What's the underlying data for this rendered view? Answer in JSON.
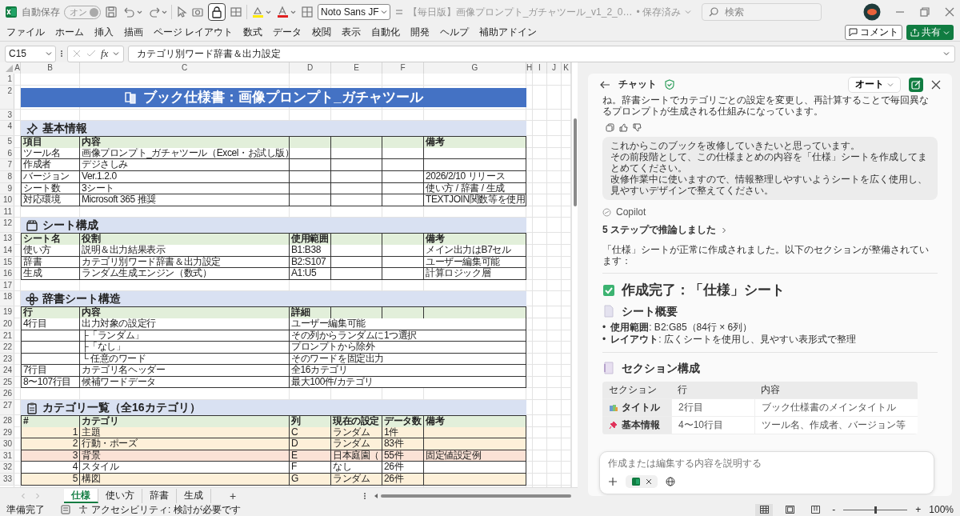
{
  "title_bar": {
    "autosave_label": "自動保存",
    "autosave": {
      "label": "オン",
      "on": true,
      "disabled": true
    },
    "font_name": "Noto Sans JF",
    "file_name": "【毎日版】画像プロンプト_ガチャツール_v1_2_0…",
    "save_status": "• 保存済み",
    "search": {
      "placeholder": "検索"
    }
  },
  "menu": {
    "items": [
      "ファイル",
      "ホーム",
      "挿入",
      "描画",
      "ページ レイアウト",
      "数式",
      "データ",
      "校閲",
      "表示",
      "自動化",
      "開発",
      "ヘルプ",
      "補助アドイン"
    ],
    "comment_button": "コメント",
    "share_button": "共有"
  },
  "formula_bar": {
    "cell": "C15",
    "fx": "fx",
    "formula": "カテゴリ別ワード辞書＆出力設定"
  },
  "sheet": {
    "columns": [
      "A",
      "B",
      "C",
      "D",
      "E",
      "F",
      "G",
      "H",
      "I",
      "J",
      "K"
    ],
    "rows": [
      {
        "number": "1",
        "kind": "blank"
      },
      {
        "number": "2",
        "kind": "title",
        "text": "ブック仕様書：画像プロンプト_ガチャツール"
      },
      {
        "number": "3",
        "kind": "blank"
      },
      {
        "number": "4",
        "kind": "section",
        "text": "基本情報"
      },
      {
        "number": "5",
        "kind": "header",
        "cells": {
          "B": "項目",
          "C": "内容",
          "G": "備考"
        }
      },
      {
        "number": "6",
        "kind": "data",
        "cells": {
          "B": "ツール名",
          "C": "画像プロンプト_ガチャツール（Excel・お試し版）"
        }
      },
      {
        "number": "7",
        "kind": "data",
        "cells": {
          "B": "作成者",
          "C": "デジさしみ"
        }
      },
      {
        "number": "8",
        "kind": "data",
        "cells": {
          "B": "バージョン",
          "C": "Ver.1.2.0",
          "G": "2026/2/10 リリース"
        }
      },
      {
        "number": "9",
        "kind": "data",
        "cells": {
          "B": "シート数",
          "C": "3シート",
          "G": "使い方 / 辞書 / 生成"
        }
      },
      {
        "number": "10",
        "kind": "data",
        "cells": {
          "B": "対応環境",
          "C": "Microsoft 365 推奨",
          "G": "TEXTJOIN関数等を使用"
        }
      },
      {
        "number": "11",
        "kind": "blank"
      },
      {
        "number": "12",
        "kind": "section",
        "text": "シート構成"
      },
      {
        "number": "13",
        "kind": "header",
        "cells": {
          "B": "シート名",
          "C": "役割",
          "D": "使用範囲",
          "G": "備考"
        }
      },
      {
        "number": "14",
        "kind": "data",
        "cells": {
          "B": "使い方",
          "C": "説明＆出力結果表示",
          "D": "B1:B38",
          "G": "メイン出力はB7セル"
        }
      },
      {
        "number": "15",
        "kind": "data",
        "cells": {
          "B": "辞書",
          "C": "カテゴリ別ワード辞書＆出力設定",
          "D": "B2:S107",
          "G": "ユーザー編集可能"
        }
      },
      {
        "number": "16",
        "kind": "data",
        "cells": {
          "B": "生成",
          "C": "ランダム生成エンジン（数式）",
          "D": "A1:U5",
          "G": "計算ロジック層"
        }
      },
      {
        "number": "17",
        "kind": "blank"
      },
      {
        "number": "18",
        "kind": "section",
        "text": "辞書シート構造"
      },
      {
        "number": "19",
        "kind": "header",
        "cells": {
          "B": "行",
          "C": "内容",
          "D": "詳細"
        }
      },
      {
        "number": "20",
        "kind": "data",
        "merged": true,
        "cells": {
          "B": "4行目",
          "C": "出力対象の設定行",
          "D": "ユーザー編集可能"
        }
      },
      {
        "number": "21",
        "kind": "data",
        "merged": true,
        "cells": {
          "C": "├「ランダム」",
          "D": "その列からランダムに1つ選択"
        }
      },
      {
        "number": "22",
        "kind": "data",
        "merged": true,
        "cells": {
          "C": "├「なし」",
          "D": "プロンプトから除外"
        }
      },
      {
        "number": "23",
        "kind": "data",
        "merged": true,
        "cells": {
          "C": "└ 任意のワード",
          "D": "そのワードを固定出力"
        }
      },
      {
        "number": "24",
        "kind": "data",
        "merged": true,
        "cells": {
          "B": "7行目",
          "C": "カテゴリ名ヘッダー",
          "D": "全16カテゴリ"
        }
      },
      {
        "number": "25",
        "kind": "data",
        "merged": true,
        "cells": {
          "B": "8〜107行目",
          "C": "候補ワードデータ",
          "D": "最大100件/カテゴリ"
        }
      },
      {
        "number": "26",
        "kind": "blank"
      },
      {
        "number": "27",
        "kind": "section",
        "text": "カテゴリ一覧（全16カテゴリ）"
      },
      {
        "number": "28",
        "kind": "header",
        "cells": {
          "B": "#",
          "C": "カテゴリ",
          "D": "列",
          "E": "現在の設定",
          "F": "データ数",
          "G": "備考"
        }
      },
      {
        "number": "29",
        "kind": "category",
        "color": "#fdf0d9",
        "cells": {
          "B": "1",
          "C": "主題",
          "D": "C",
          "E": "ランダム",
          "F": "1件"
        }
      },
      {
        "number": "30",
        "kind": "category",
        "color": "#fdf0d9",
        "cells": {
          "B": "2",
          "C": "行動・ポーズ",
          "D": "D",
          "E": "ランダム",
          "F": "83件"
        }
      },
      {
        "number": "31",
        "kind": "category",
        "color": "#fbe2d6",
        "cells": {
          "B": "3",
          "C": "背景",
          "D": "E",
          "E": "日本庭園（",
          "F": "55件",
          "G": "固定値設定例"
        }
      },
      {
        "number": "32",
        "kind": "category",
        "color": "#ffffff",
        "cells": {
          "B": "4",
          "C": "スタイル",
          "D": "F",
          "E": "なし",
          "F": "26件"
        }
      },
      {
        "number": "33",
        "kind": "category",
        "color": "#fdf0d9",
        "cells": {
          "B": "5",
          "C": "構図",
          "D": "G",
          "E": "ランダム",
          "F": "26件"
        }
      }
    ]
  },
  "sheet_tabs": {
    "tabs": [
      {
        "label": "仕様",
        "selected": true
      },
      {
        "label": "使い方",
        "selected": false
      },
      {
        "label": "辞書",
        "selected": false
      },
      {
        "label": "生成",
        "selected": false
      }
    ],
    "add": "+"
  },
  "chat": {
    "title": "チャット",
    "mode": "オート",
    "messages": [
      {
        "kind": "text",
        "text": "ね。辞書シートでカテゴリごとの設定を変更し、再計算することで毎回異なるプロンプトが生成される仕組みになっています。",
        "feedback": true
      },
      {
        "kind": "user",
        "paragraphs": [
          "これからこのブックを改修していきたいと思っています。",
          "その前段階として、この仕様まとめの内容を「仕様」シートを作成してまとめてください。",
          "改修作業中に使いますので、情報整理しやすいようシートを広く使用し、見やすいデザインで整えてください。"
        ]
      },
      {
        "kind": "sender",
        "name": "Copilot"
      },
      {
        "kind": "reasoning",
        "text": "5 ステップで推論しました"
      },
      {
        "kind": "text",
        "text": "「仕様」シートが正常に作成されました。以下のセクションが整備されています：",
        "feedback": false
      },
      {
        "kind": "rule"
      },
      {
        "kind": "h2",
        "text": "作成完了：「仕様」シート"
      },
      {
        "kind": "h3",
        "text": "シート概要"
      },
      {
        "kind": "bullets",
        "items": [
          {
            "marker": "•",
            "text": "**使用範囲**: B2:G85（84行 × 6列）"
          },
          {
            "marker": "•",
            "text": "**レイアウト**: 広くシートを使用し、見やすい表形式で整理"
          }
        ]
      },
      {
        "kind": "rule"
      },
      {
        "kind": "h3",
        "text": "セクション構成"
      },
      {
        "kind": "table",
        "columns": [
          "セクション",
          "行",
          "内容"
        ],
        "rows": [
          [
            "タイトル",
            "2行目",
            "ブック仕様書のメインタイトル"
          ],
          [
            "基本情報",
            "4〜10行目",
            "ツール名、作成者、バージョン等"
          ]
        ]
      }
    ],
    "input": {
      "placeholder": "作成または編集する内容を説明する"
    }
  },
  "status_bar": {
    "ready": "準備完了",
    "accessibility": "アクセシビリティ: 検討が必要です",
    "zoom": {
      "minus": "-",
      "plus": "+",
      "level": 0.5,
      "reading": "100%"
    }
  }
}
